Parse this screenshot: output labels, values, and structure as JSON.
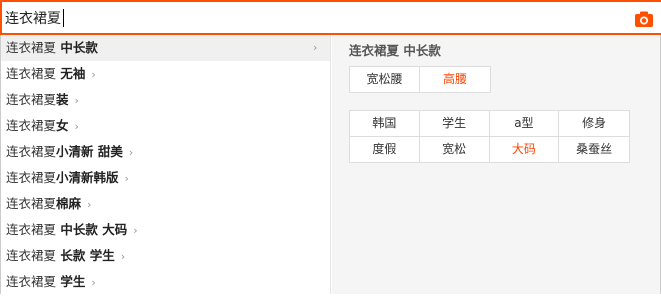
{
  "search": {
    "query": "连衣裙夏"
  },
  "suggestions": [
    {
      "prefix": "连衣裙夏",
      "keyword": " 中长款",
      "active": true
    },
    {
      "prefix": "连衣裙夏",
      "keyword": " 无袖",
      "active": false
    },
    {
      "prefix": "连衣裙夏",
      "keyword": "装",
      "active": false
    },
    {
      "prefix": "连衣裙夏",
      "keyword": "女",
      "active": false
    },
    {
      "prefix": "连衣裙夏",
      "keyword": "小清新 甜美",
      "active": false
    },
    {
      "prefix": "连衣裙夏",
      "keyword": "小清新韩版",
      "active": false
    },
    {
      "prefix": "连衣裙夏",
      "keyword": "棉麻",
      "active": false
    },
    {
      "prefix": "连衣裙夏",
      "keyword": " 中长款 大码",
      "active": false
    },
    {
      "prefix": "连衣裙夏",
      "keyword": " 长款 学生",
      "active": false
    },
    {
      "prefix": "连衣裙夏",
      "keyword": " 学生",
      "active": false
    }
  ],
  "panel": {
    "title": "连衣裙夏 中长款",
    "pair": [
      "宽松腰",
      "高腰"
    ],
    "grid": [
      [
        "韩国",
        "学生",
        "a型",
        "修身"
      ],
      [
        "度假",
        "宽松",
        "大码",
        "桑蚕丝"
      ]
    ]
  },
  "colors": {
    "accent": "#ff5000",
    "highlight_text": "#f40",
    "panel_bg": "#f5f5f5",
    "active_row_bg": "#f0f0f0"
  },
  "icons": {
    "search_tool": "camera-icon",
    "row_arrow": "chevron-right-icon"
  }
}
